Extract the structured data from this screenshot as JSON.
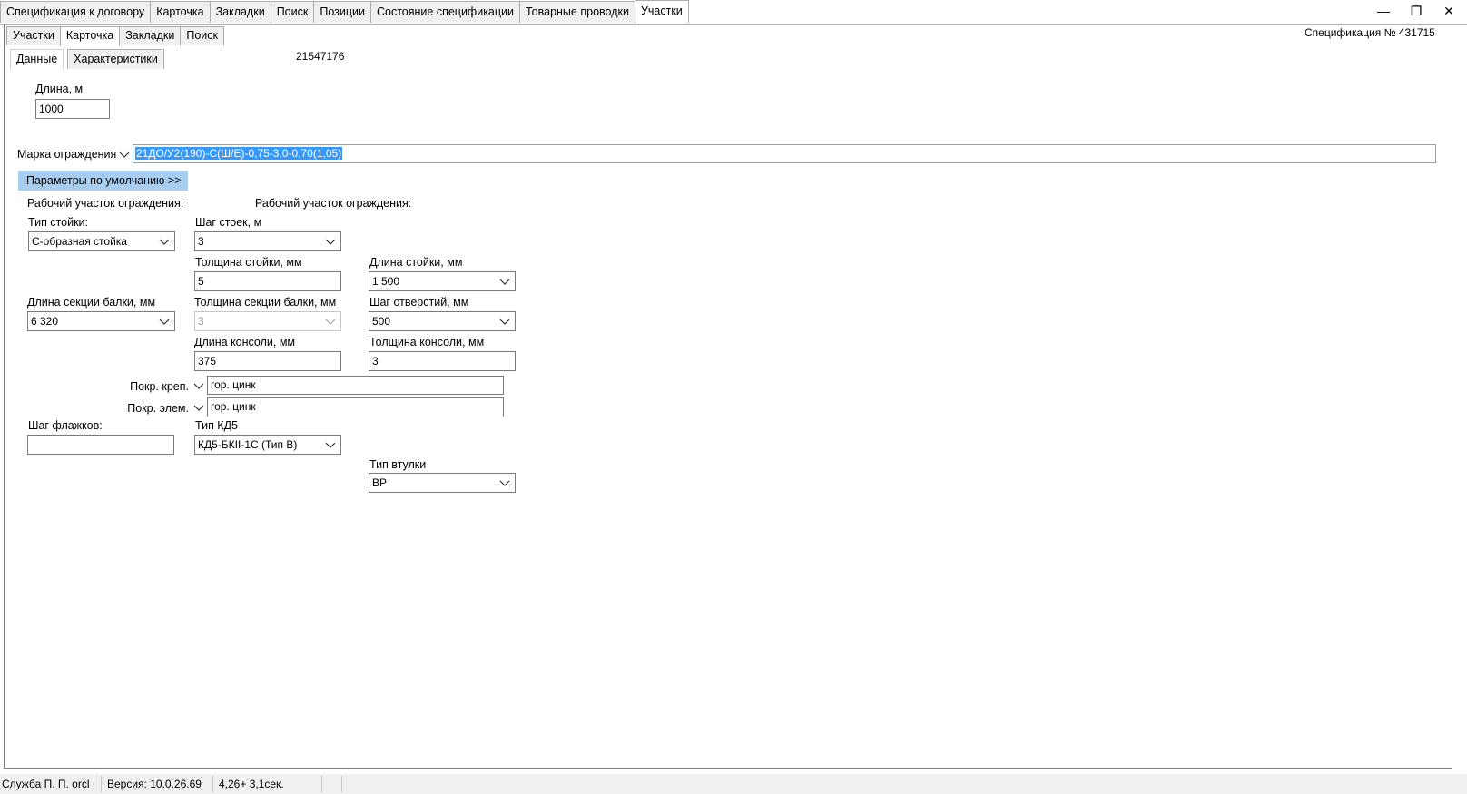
{
  "top_tabs": [
    {
      "label": "Спецификация к договору",
      "active": false
    },
    {
      "label": "Карточка",
      "active": false
    },
    {
      "label": "Закладки",
      "active": false
    },
    {
      "label": "Поиск",
      "active": false
    },
    {
      "label": "Позиции",
      "active": false
    },
    {
      "label": "Состояние спецификации",
      "active": false
    },
    {
      "label": "Товарные проводки",
      "active": false
    },
    {
      "label": "Участки",
      "active": true
    }
  ],
  "window": {
    "minimize": "—",
    "restore": "❐",
    "close": "✕"
  },
  "sub_tabs": [
    {
      "label": "Участки",
      "active": false
    },
    {
      "label": "Карточка",
      "active": true
    },
    {
      "label": "Закладки",
      "active": false
    },
    {
      "label": "Поиск",
      "active": false
    }
  ],
  "spec_number": "Спецификация № 431715",
  "data_tabs": [
    {
      "label": "Данные",
      "active": true
    },
    {
      "label": "Характеристики",
      "active": false
    }
  ],
  "record_id": "21547176",
  "form": {
    "length_label": "Длина, м",
    "length_value": "1000",
    "marka_label": "Марка ограждения",
    "marka_value": "21ДО/У2(190)-С(Ш/Е)-0,75-3,0-0,70(1,05)",
    "default_params_button": "Параметры по умолчанию >>",
    "work_section_label_1": "Рабочий участок ограждения:",
    "work_section_label_2": "Рабочий участок ограждения:",
    "post_type_label": "Тип стойки:",
    "post_type_value": "С-образная стойка",
    "post_step_label": "Шаг стоек, м",
    "post_step_value": "3",
    "post_thickness_label": "Толщина стойки, мм",
    "post_thickness_value": "5",
    "post_length_label": "Длина стойки, мм",
    "post_length_value": "1 500",
    "beam_length_label": "Длина секции балки, мм",
    "beam_length_value": "6 320",
    "beam_thickness_label": "Толщина секции балки, мм",
    "beam_thickness_value": "3",
    "hole_step_label": "Шаг отверстий, мм",
    "hole_step_value": "500",
    "console_length_label": "Длина консоли, мм",
    "console_length_value": "375",
    "console_thickness_label": "Толщина консоли, мм",
    "console_thickness_value": "3",
    "coat_fastener_label": "Покр. креп.",
    "coat_fastener_value": "гор. цинк",
    "coat_element_label": "Покр. элем.",
    "coat_element_value": "гор. цинк",
    "flag_step_label": "Шаг флажков:",
    "flag_step_value": "",
    "kd5_type_label": "Тип КД5",
    "kd5_type_value": "КД5-БКII-1С (Тип В)",
    "sleeve_type_label": "Тип втулки",
    "sleeve_type_value": "ВР"
  },
  "status_bar": {
    "user": "Служба П. П. orcl",
    "version": "Версия: 10.0.26.69",
    "timing": "4,26+ 3,1сек.",
    "extra": ""
  }
}
